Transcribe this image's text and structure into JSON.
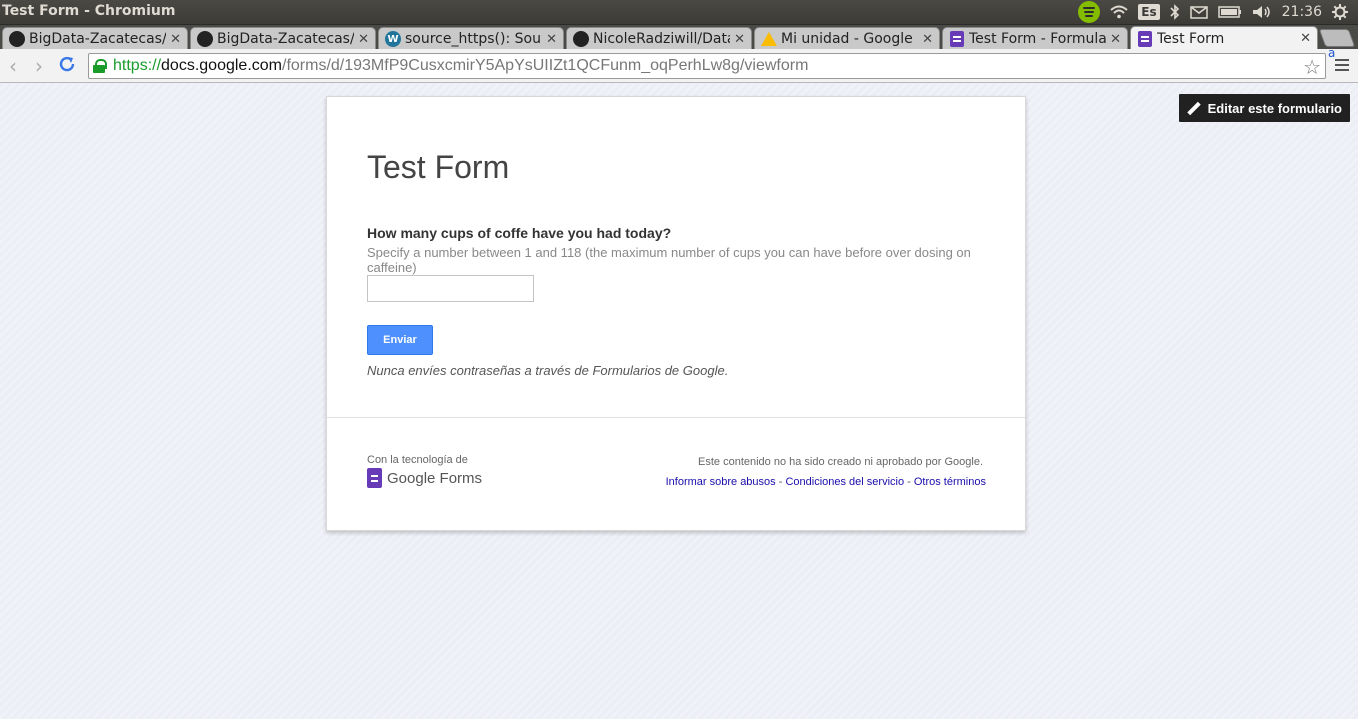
{
  "window": {
    "title": "Test Form - Chromium"
  },
  "tray": {
    "keyboard": "Es",
    "clock": "21:36"
  },
  "tabs": [
    {
      "label": "BigData-Zacatecas/sc",
      "icon": "github-icon"
    },
    {
      "label": "BigData-Zacatecas/sc",
      "icon": "github-icon"
    },
    {
      "label": "source_https(): Sourc",
      "icon": "wordpress-icon"
    },
    {
      "label": "NicoleRadziwill/Data",
      "icon": "github-icon"
    },
    {
      "label": "Mi unidad - Google Dr",
      "icon": "google-drive-icon"
    },
    {
      "label": "Test Form - Formulari",
      "icon": "google-forms-icon"
    },
    {
      "label": "Test Form",
      "icon": "google-forms-icon"
    }
  ],
  "address_bar": {
    "scheme": "https://",
    "host": "docs.google.com",
    "path": "/forms/d/193MfP9CusxcmirY5ApYsUIIZt1QCFunm_oqPerhLw8g/viewform"
  },
  "extension_label": "a",
  "page": {
    "edit_button": "Editar este formulario",
    "form_title": "Test Form",
    "question": {
      "title": "How many cups of coffe have you had today?",
      "help": "Specify a number between 1 and 118 (the maximum number of cups you can have before over dosing on caffeine)",
      "value": ""
    },
    "submit_label": "Enviar",
    "password_warning": "Nunca envíes contraseñas a través de Formularios de Google.",
    "footer": {
      "powered_by": "Con la tecnología de",
      "logo_text": "Google Forms",
      "disclaimer": "Este contenido no ha sido creado ni aprobado por Google.",
      "link_abuse": "Informar sobre abusos",
      "link_terms": "Condiciones del servicio",
      "link_other": "Otros términos",
      "separator": " - "
    }
  },
  "colors": {
    "accent_blue": "#4d90fe",
    "forms_purple": "#673ab7",
    "secure_green": "#1a9c2b"
  }
}
